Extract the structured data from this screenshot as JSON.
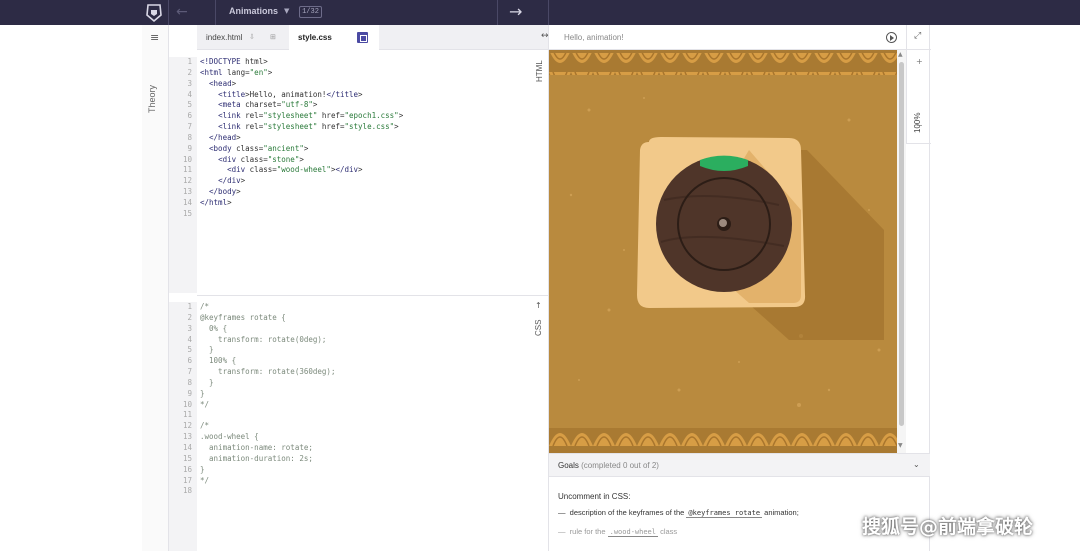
{
  "topbar": {
    "back_icon": "←",
    "title": "Animations",
    "caret": "▼",
    "counter": "1/32",
    "forward_icon": "→"
  },
  "theory": {
    "menu_icon": "≡",
    "label": "Theory"
  },
  "tabs": [
    {
      "label": "index.html",
      "icon": "⇩",
      "extra_icon": "⊞"
    },
    {
      "label": "style.css"
    }
  ],
  "html_editor": {
    "label": "HTML",
    "line_numbers": [
      "1",
      "2",
      "3",
      "4",
      "5",
      "6",
      "7",
      "8",
      "9",
      "10",
      "11",
      "12",
      "13",
      "14",
      "15"
    ],
    "lines": [
      "<!DOCTYPE html>",
      "<html lang=\"en\">",
      "  <head>",
      "    <title>Hello, animation!</title>",
      "    <meta charset=\"utf-8\">",
      "    <link rel=\"stylesheet\" href=\"epoch1.css\">",
      "    <link rel=\"stylesheet\" href=\"style.css\">",
      "  </head>",
      "  <body class=\"ancient\">",
      "    <div class=\"stone\">",
      "      <div class=\"wood-wheel\"></div>",
      "    </div>",
      "  </body>",
      "</html>",
      ""
    ]
  },
  "css_editor": {
    "label": "CSS",
    "up_icon": "↑",
    "line_numbers": [
      "1",
      "2",
      "3",
      "4",
      "5",
      "6",
      "7",
      "8",
      "9",
      "10",
      "11",
      "12",
      "13",
      "14",
      "15",
      "16",
      "17",
      "18"
    ],
    "lines": [
      "/*",
      "@keyframes rotate {",
      "  0% {",
      "    transform: rotate(0deg);",
      "  }",
      "  100% {",
      "    transform: rotate(360deg);",
      "  }",
      "}",
      "*/",
      "",
      "/*",
      ".wood-wheel {",
      "  animation-name: rotate;",
      "  animation-duration: 2s;",
      "}",
      "*/",
      ""
    ]
  },
  "preview": {
    "swap_icon": "↔",
    "title": "Hello, animation!",
    "expand_icon": "⤢",
    "plus": "+",
    "zoom": "100%",
    "minus": "−",
    "scroll_up": "▲",
    "scroll_down": "▼",
    "colors": {
      "sand": "#b98a3e",
      "sand_dark": "#8d6420",
      "stone": "#f2c98a",
      "wheel": "#4f3529",
      "accent": "#2bae5f"
    }
  },
  "goals": {
    "label": "Goals",
    "completed": "(completed 0 out of 2)",
    "chevron": "⌄",
    "intro": "Uncomment in CSS:",
    "items": [
      {
        "bullet": "—",
        "before": "description of the keyframes of the",
        "code": "@keyframes rotate",
        "after": "animation;"
      },
      {
        "bullet": "—",
        "before": "rule for the",
        "code": ".wood-wheel",
        "after": "class"
      }
    ]
  },
  "watermark": "搜狐号@前端拿破轮"
}
